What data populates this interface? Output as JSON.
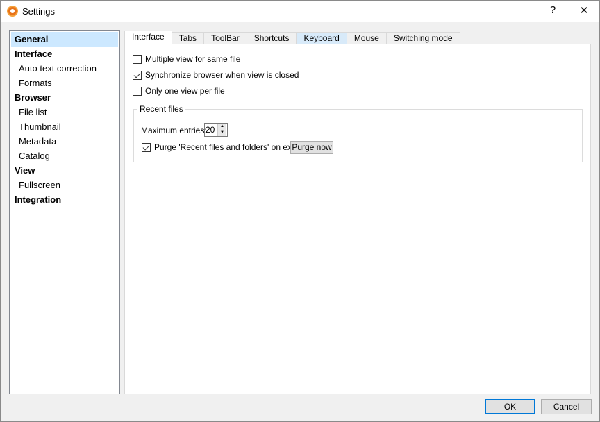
{
  "window": {
    "title": "Settings",
    "help": "?",
    "close": "✕"
  },
  "sidebar": {
    "items": [
      {
        "label": "General",
        "level": "top",
        "selected": true
      },
      {
        "label": "Interface",
        "level": "top"
      },
      {
        "label": "Auto text correction",
        "level": "sub"
      },
      {
        "label": "Formats",
        "level": "sub"
      },
      {
        "label": "Browser",
        "level": "top"
      },
      {
        "label": "File list",
        "level": "sub"
      },
      {
        "label": "Thumbnail",
        "level": "sub"
      },
      {
        "label": "Metadata",
        "level": "sub"
      },
      {
        "label": "Catalog",
        "level": "sub"
      },
      {
        "label": "View",
        "level": "top"
      },
      {
        "label": "Fullscreen",
        "level": "sub"
      },
      {
        "label": "Integration",
        "level": "top"
      }
    ]
  },
  "tabs": [
    "Interface",
    "Tabs",
    "ToolBar",
    "Shortcuts",
    "Keyboard",
    "Mouse",
    "Switching mode"
  ],
  "options": {
    "multiple_view": {
      "label": "Multiple view for same file",
      "checked": false
    },
    "sync_browser": {
      "label": "Synchronize browser when view is closed",
      "checked": true
    },
    "one_view": {
      "label": "Only one view per file",
      "checked": false
    }
  },
  "recent": {
    "title": "Recent files",
    "max_label": "Maximum entries:",
    "max_value": "20",
    "purge_label": "Purge 'Recent files and folders' on exit",
    "purge_checked": true,
    "purge_now": "Purge now"
  },
  "footer": {
    "ok": "OK",
    "cancel": "Cancel"
  }
}
